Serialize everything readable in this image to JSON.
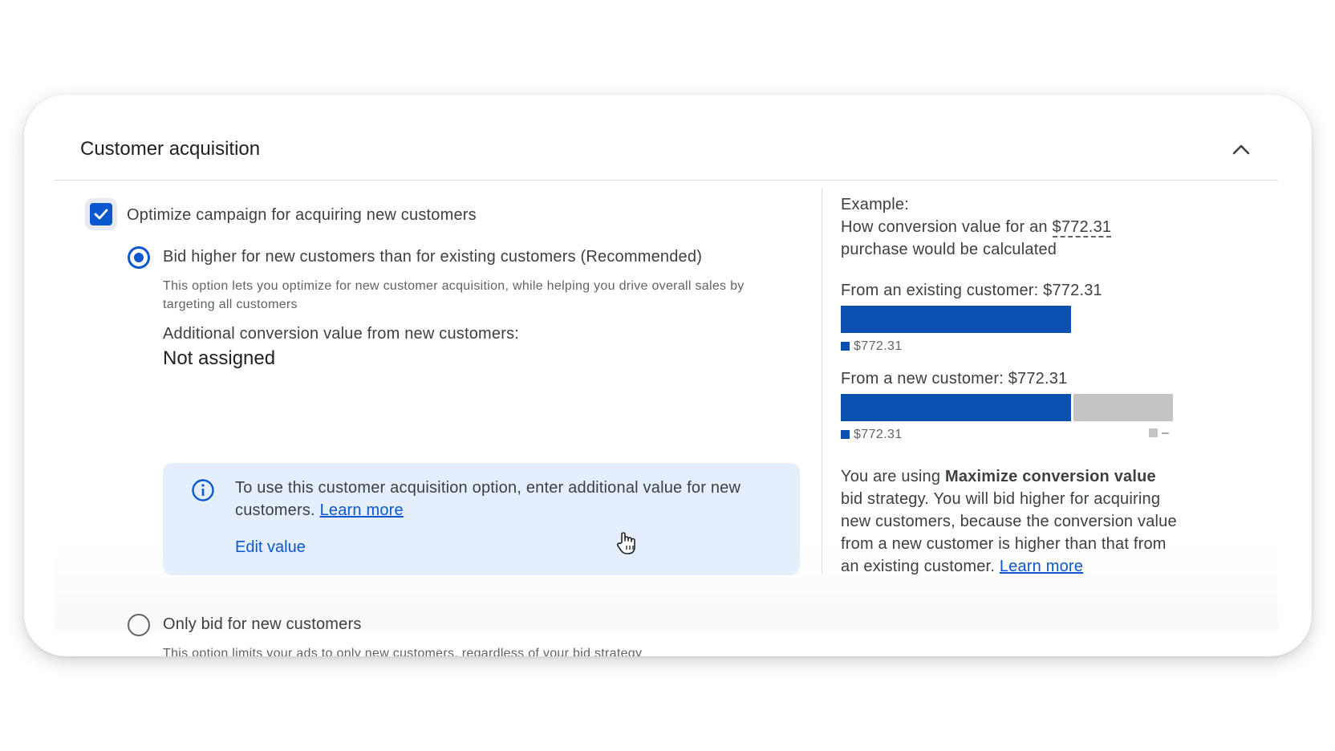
{
  "section": {
    "title": "Customer acquisition",
    "collapse_icon": "chevron-up-icon"
  },
  "optimize": {
    "checked": true,
    "label": "Optimize campaign for acquiring new customers"
  },
  "options": [
    {
      "selected": true,
      "label": "Bid higher for new customers than for existing customers (Recommended)",
      "description_line1": "This option lets you optimize for new customer acquisition, while helping you drive overall sales by",
      "description_line2": "targeting all customers"
    },
    {
      "selected": false,
      "label": "Only bid for new customers",
      "description": "This option limits your ads to only new customers, regardless of your bid strategy"
    }
  ],
  "additional_value": {
    "label": "Additional conversion value from new customers:",
    "value": "Not assigned"
  },
  "info": {
    "icon": "info-icon",
    "text": "To use this customer acquisition option, enter additional value for new customers. ",
    "link": "Learn more",
    "button": "Edit value"
  },
  "example": {
    "heading": "Example:",
    "line1_prefix": "How conversion value for an ",
    "amount": "$772.31",
    "line2": "purchase would be calculated",
    "existing_label": "From an existing customer: $772.31",
    "existing_legend": "$772.31",
    "new_label": "From a new customer: $772.31",
    "new_legend": "$772.31",
    "new_extra_legend": "–",
    "explanation_prefix": "You are using ",
    "explanation_bold": "Maximize conversion value",
    "explanation_suffix": " bid strategy. You will bid higher for acquiring new customers, because the conversion value from a new customer is higher than that from an existing customer. ",
    "explanation_link": "Learn more"
  },
  "colors": {
    "primary": "#0b57d0",
    "bar_blue": "#0b4fb0",
    "bar_grey": "#c4c4c4",
    "info_bg": "#e5eefc"
  }
}
